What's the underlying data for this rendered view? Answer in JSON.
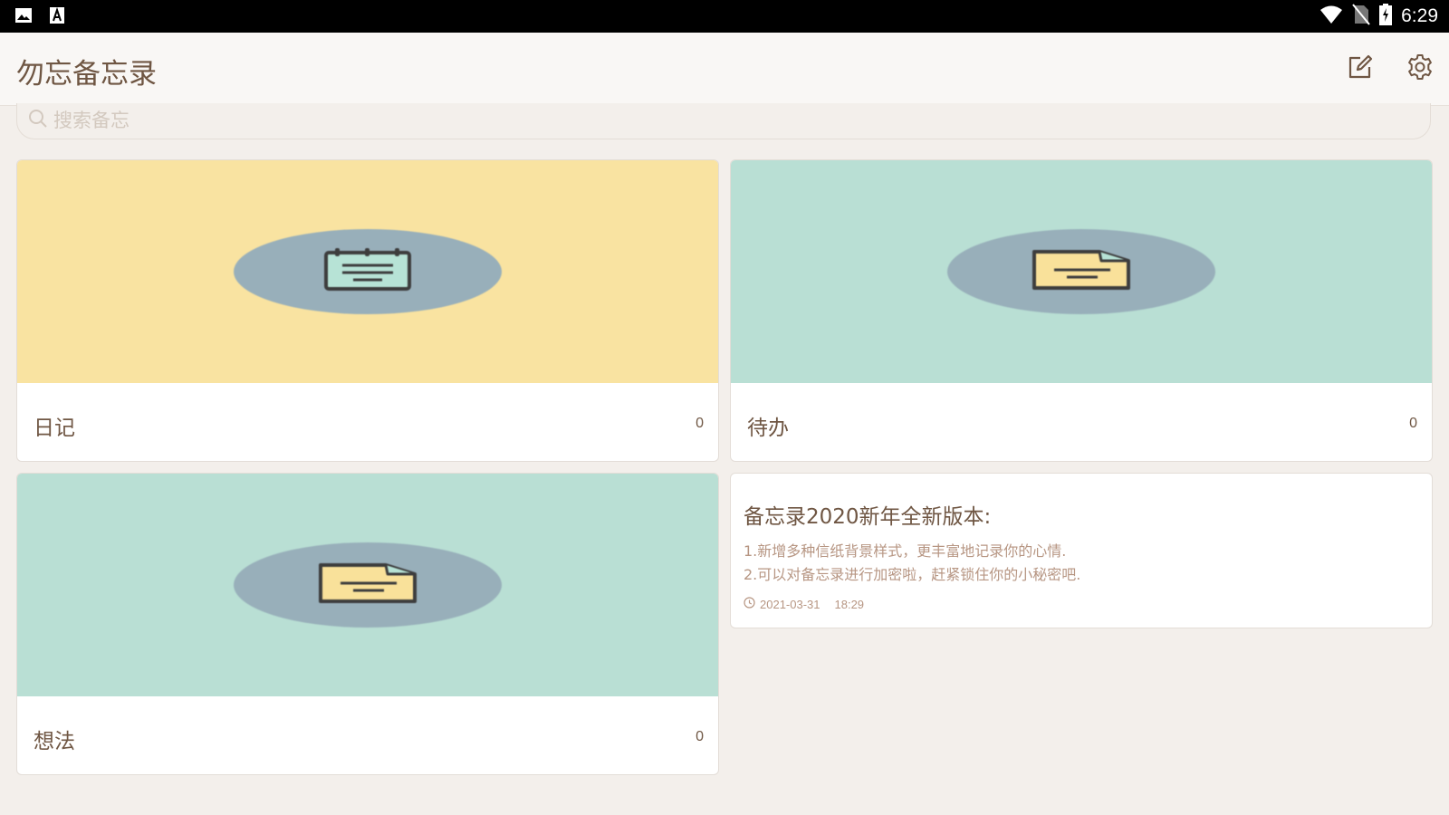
{
  "status_bar": {
    "time": "6:29",
    "icons": [
      "image-icon",
      "a-icon",
      "wifi-icon",
      "no-sim-icon",
      "battery-charging-icon"
    ]
  },
  "app_bar": {
    "title": "勿忘备忘录",
    "actions": [
      "edit-icon",
      "settings-gear-icon"
    ]
  },
  "search": {
    "placeholder": "搜索备忘",
    "value": ""
  },
  "folders": [
    {
      "name": "日记",
      "count": "0",
      "cover_color": "#f9e3a1",
      "icon": "notepad-icon"
    },
    {
      "name": "待办",
      "count": "0",
      "cover_color": "#b9dfd4",
      "icon": "document-icon"
    },
    {
      "name": "想法",
      "count": "0",
      "cover_color": "#b9dfd4",
      "icon": "document-icon"
    }
  ],
  "note": {
    "title": "备忘录2020新年全新版本:",
    "lines": [
      "1.新增多种信纸背景样式，更丰富地记录你的心情.",
      "2.可以对备忘录进行加密啦，赶紧锁住你的小秘密吧."
    ],
    "date": "2021-03-31",
    "time": "18:29"
  },
  "colors": {
    "background": "#f3efeb",
    "text_primary": "#6f5643",
    "text_secondary": "#b79683",
    "ellipse": "#98afba",
    "yellow_cover": "#f9e3a1",
    "teal_cover": "#b9dfd4"
  }
}
